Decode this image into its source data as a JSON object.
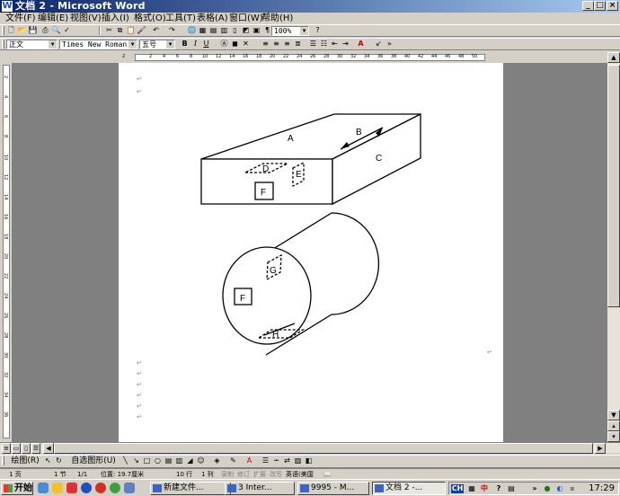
{
  "window": {
    "app_icon": "W",
    "title": "文档 2 - Microsoft Word",
    "min": "_",
    "max": "□",
    "close": "×"
  },
  "menu": [
    "文件(F)",
    "编辑(E)",
    "视图(V)",
    "插入(I)",
    "格式(O)",
    "工具(T)",
    "表格(A)",
    "窗口(W)",
    "帮助(H)"
  ],
  "standard_toolbar": {
    "zoom": "100%"
  },
  "format_toolbar": {
    "style": "正文",
    "font": "Times New Roman",
    "size": "五号",
    "bold": "B",
    "italic": "I",
    "underline": "U",
    "font_color": "A"
  },
  "ruler": {
    "ticks": [
      "2",
      "2",
      "4",
      "6",
      "8",
      "10",
      "12",
      "14",
      "16",
      "18",
      "20",
      "22",
      "24",
      "26",
      "28",
      "30",
      "32",
      "34",
      "36",
      "38",
      "40",
      "42",
      "44",
      "46",
      "48",
      "50"
    ],
    "vticks": [
      "2",
      "4",
      "6",
      "8",
      "10",
      "12",
      "14",
      "16",
      "18",
      "20",
      "22",
      "24",
      "26",
      "28",
      "30",
      "32",
      "34",
      "36"
    ]
  },
  "figure": {
    "box_labels": {
      "top": "A",
      "arrow": "B",
      "side": "C",
      "hidden_top": "D",
      "hidden_side": "E",
      "front": "F"
    },
    "cylinder_labels": {
      "face": "F",
      "top": "G",
      "bottom": "H"
    }
  },
  "drawing_toolbar": {
    "draw": "绘图(R)",
    "autoshapes": "自选图形(U)"
  },
  "status": {
    "page": "1 页",
    "section": "1 节",
    "page_of": "1/1",
    "position": "位置: 19.7厘米",
    "line": "10 行",
    "column": "1 列",
    "rec": "录制",
    "trk": "修订",
    "ext": "扩展",
    "ovr": "改写",
    "language": "英语(美国"
  },
  "taskbar": {
    "start": "开始",
    "tasks": [
      "新建文件...",
      "3 Inter...",
      "9995 - M...",
      "文档 2 -..."
    ],
    "tray": {
      "lang": "CH",
      "ime": "中",
      "clock": "17:29"
    }
  }
}
